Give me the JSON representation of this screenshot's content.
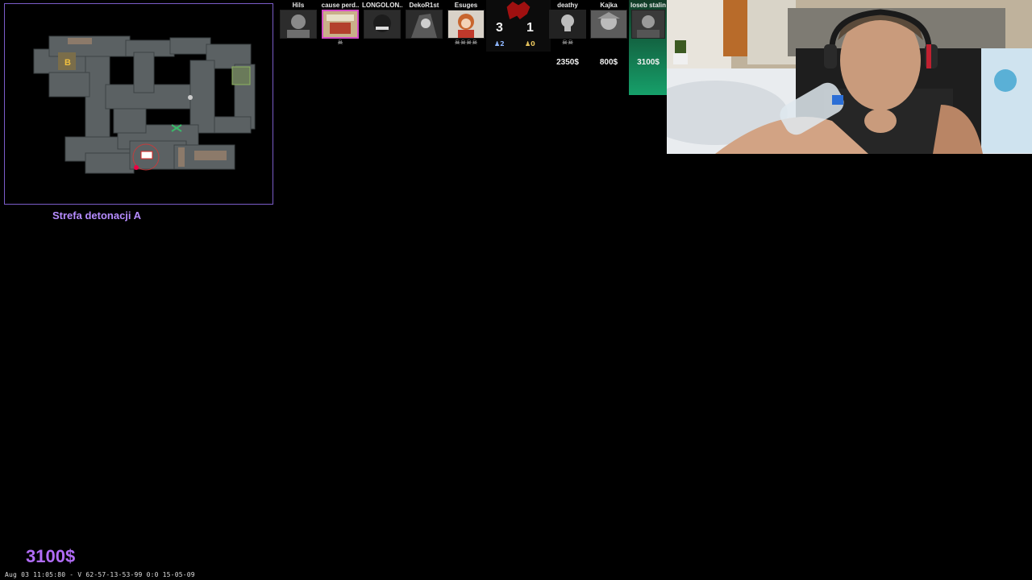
{
  "radar": {
    "zone_label": "Strefa detonacji A",
    "site_b_marker": "B"
  },
  "team_left": [
    {
      "name": "Hils",
      "status": "dead",
      "kills": ""
    },
    {
      "name": "cause perd..",
      "status": "alive",
      "kills": "☠",
      "highlighted": true
    },
    {
      "name": "LONGOLON..",
      "status": "dead",
      "kills": ""
    },
    {
      "name": "DekoR1st",
      "status": "dead",
      "kills": ""
    },
    {
      "name": "Esuges",
      "status": "alive",
      "kills": "☠☠☠☠"
    }
  ],
  "scoreboard": {
    "score_left": "3",
    "score_right": "1",
    "alive_left": "♟2",
    "alive_right": "♟0",
    "colors": {
      "left": "#8fb8ff",
      "right": "#e6c35c",
      "logo": "#a01010"
    }
  },
  "team_right": [
    {
      "name": "deathy",
      "status": "dead",
      "kills": "☠☠",
      "money": "2350$"
    },
    {
      "name": "Kajka",
      "status": "dead",
      "kills": "",
      "money": "800$"
    },
    {
      "name": "Ioseb stalin",
      "status": "selected",
      "kills": "",
      "money": "3100$"
    }
  ],
  "player": {
    "money": "3100$"
  },
  "footer": {
    "timestamp": "Aug 03 11:05:80 - V 62-57-13-53-99 0:0 15-05-09"
  },
  "colors": {
    "accent": "#b16cf7",
    "radar_border": "#7b5cc9",
    "selected_card": "#16a06a"
  }
}
